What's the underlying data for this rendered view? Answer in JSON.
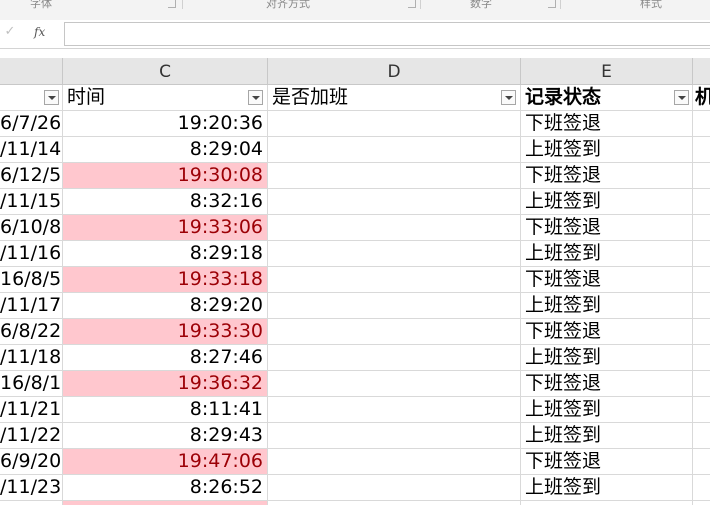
{
  "ribbon": {
    "groups": [
      "字体",
      "对齐方式",
      "数字",
      "样式"
    ]
  },
  "formula_bar": {
    "check_glyph": "✓",
    "fx_glyph": "fx",
    "value": ""
  },
  "columns": [
    "C",
    "D",
    "E"
  ],
  "header_row": {
    "col_b_partial": "",
    "col_c": "时间",
    "col_d": "是否加班",
    "col_e": "记录状态",
    "col_f_partial": "机"
  },
  "rows": [
    {
      "date": "6/7/26",
      "time": "19:20:36",
      "overtime": "",
      "status": "下班签退",
      "highlight": false
    },
    {
      "date": "/11/14",
      "time": "8:29:04",
      "overtime": "",
      "status": "上班签到",
      "highlight": false
    },
    {
      "date": "6/12/5",
      "time": "19:30:08",
      "overtime": "",
      "status": "下班签退",
      "highlight": true
    },
    {
      "date": "/11/15",
      "time": "8:32:16",
      "overtime": "",
      "status": "上班签到",
      "highlight": false
    },
    {
      "date": "6/10/8",
      "time": "19:33:06",
      "overtime": "",
      "status": "下班签退",
      "highlight": true
    },
    {
      "date": "/11/16",
      "time": "8:29:18",
      "overtime": "",
      "status": "上班签到",
      "highlight": false
    },
    {
      "date": "16/8/5",
      "time": "19:33:18",
      "overtime": "",
      "status": "下班签退",
      "highlight": true
    },
    {
      "date": "/11/17",
      "time": "8:29:20",
      "overtime": "",
      "status": "上班签到",
      "highlight": false
    },
    {
      "date": "6/8/22",
      "time": "19:33:30",
      "overtime": "",
      "status": "下班签退",
      "highlight": true
    },
    {
      "date": "/11/18",
      "time": "8:27:46",
      "overtime": "",
      "status": "上班签到",
      "highlight": false
    },
    {
      "date": "16/8/1",
      "time": "19:36:32",
      "overtime": "",
      "status": "下班签退",
      "highlight": true
    },
    {
      "date": "/11/21",
      "time": "8:11:41",
      "overtime": "",
      "status": "上班签到",
      "highlight": false
    },
    {
      "date": "/11/22",
      "time": "8:29:43",
      "overtime": "",
      "status": "上班签到",
      "highlight": false
    },
    {
      "date": "6/9/20",
      "time": "19:47:06",
      "overtime": "",
      "status": "下班签退",
      "highlight": true
    },
    {
      "date": "/11/23",
      "time": "8:26:52",
      "overtime": "",
      "status": "上班签到",
      "highlight": false
    },
    {
      "date": "",
      "time": "",
      "overtime": "",
      "status": "",
      "highlight": true
    }
  ],
  "colors": {
    "highlight_fill": "#ffc7ce",
    "highlight_text": "#9c0006",
    "header_bg": "#e6e6e6"
  }
}
